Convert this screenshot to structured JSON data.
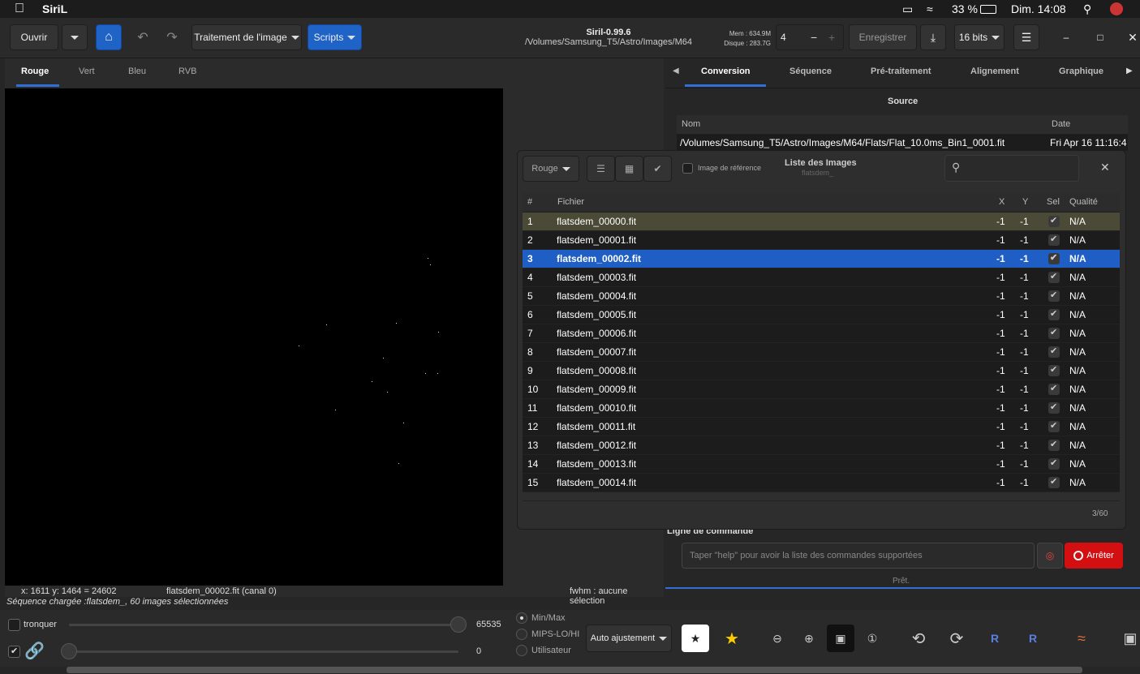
{
  "menubar": {
    "app": "SiriL",
    "battery": "33 %",
    "clock": "Dim. 14:08"
  },
  "toolbar": {
    "open": "Ouvrir",
    "image_processing": "Traitement de l'image",
    "scripts": "Scripts",
    "title": "Siril-0.99.6",
    "path": "/Volumes/Samsung_T5/Astro/Images/M64",
    "mem": "Mem : 634.9M",
    "disk": "Disque : 283.7G",
    "threads": "4",
    "save": "Enregistrer",
    "bits": "16 bits"
  },
  "left": {
    "tabs": [
      "Rouge",
      "Vert",
      "Bleu",
      "RVB"
    ],
    "coords": "x: 1611 y: 1464 = 24602",
    "file": "flatsdem_00002.fit (canal 0)",
    "fwhm": "fwhm : aucune sélection",
    "seq": "Séquence chargée :flatsdem_, 60 images sélectionnées"
  },
  "bottom": {
    "tronquer": "tronquer",
    "max": "65535",
    "min": "0",
    "minmax": "Min/Max",
    "mips": "MIPS-LO/HI",
    "user": "Utilisateur",
    "auto": "Auto ajustement"
  },
  "right": {
    "tabs": [
      "Conversion",
      "Séquence",
      "Pré-traitement",
      "Alignement",
      "Graphique"
    ],
    "source": "Source",
    "col_name": "Nom",
    "col_date": "Date",
    "file": "/Volumes/Samsung_T5/Astro/Images/M64/Flats/Flat_10.0ms_Bin1_0001.fit",
    "date": "Fri Apr 16 11:16:4",
    "cmd_label": "Ligne de commande",
    "cmd_placeholder": "Taper \"help\" pour avoir la liste des commandes supportées",
    "stop": "Arrêter",
    "status": "Prêt."
  },
  "dialog": {
    "channel": "Rouge",
    "ref": "Image de référence",
    "title": "Liste des Images",
    "subtitle": "flatsdem_",
    "count": "3/60",
    "headers": {
      "num": "#",
      "file": "Fichier",
      "x": "X",
      "y": "Y",
      "sel": "Sel",
      "quality": "Qualité"
    },
    "rows": [
      {
        "n": "1",
        "f": "flatsdem_00000.fit",
        "x": "-1",
        "y": "-1",
        "q": "N/A"
      },
      {
        "n": "2",
        "f": "flatsdem_00001.fit",
        "x": "-1",
        "y": "-1",
        "q": "N/A"
      },
      {
        "n": "3",
        "f": "flatsdem_00002.fit",
        "x": "-1",
        "y": "-1",
        "q": "N/A"
      },
      {
        "n": "4",
        "f": "flatsdem_00003.fit",
        "x": "-1",
        "y": "-1",
        "q": "N/A"
      },
      {
        "n": "5",
        "f": "flatsdem_00004.fit",
        "x": "-1",
        "y": "-1",
        "q": "N/A"
      },
      {
        "n": "6",
        "f": "flatsdem_00005.fit",
        "x": "-1",
        "y": "-1",
        "q": "N/A"
      },
      {
        "n": "7",
        "f": "flatsdem_00006.fit",
        "x": "-1",
        "y": "-1",
        "q": "N/A"
      },
      {
        "n": "8",
        "f": "flatsdem_00007.fit",
        "x": "-1",
        "y": "-1",
        "q": "N/A"
      },
      {
        "n": "9",
        "f": "flatsdem_00008.fit",
        "x": "-1",
        "y": "-1",
        "q": "N/A"
      },
      {
        "n": "10",
        "f": "flatsdem_00009.fit",
        "x": "-1",
        "y": "-1",
        "q": "N/A"
      },
      {
        "n": "11",
        "f": "flatsdem_00010.fit",
        "x": "-1",
        "y": "-1",
        "q": "N/A"
      },
      {
        "n": "12",
        "f": "flatsdem_00011.fit",
        "x": "-1",
        "y": "-1",
        "q": "N/A"
      },
      {
        "n": "13",
        "f": "flatsdem_00012.fit",
        "x": "-1",
        "y": "-1",
        "q": "N/A"
      },
      {
        "n": "14",
        "f": "flatsdem_00013.fit",
        "x": "-1",
        "y": "-1",
        "q": "N/A"
      },
      {
        "n": "15",
        "f": "flatsdem_00014.fit",
        "x": "-1",
        "y": "-1",
        "q": "N/A"
      }
    ]
  }
}
